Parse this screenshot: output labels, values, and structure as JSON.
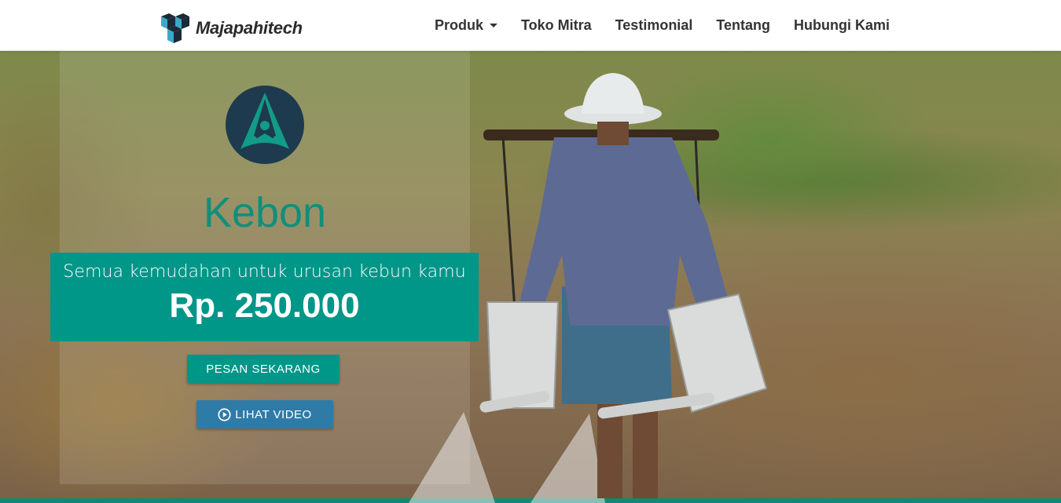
{
  "brand": {
    "name": "Majapahitech"
  },
  "nav": {
    "items": [
      {
        "label": "Produk",
        "has_dropdown": true
      },
      {
        "label": "Toko Mitra"
      },
      {
        "label": "Testimonial"
      },
      {
        "label": "Tentang"
      },
      {
        "label": "Hubungi Kami"
      }
    ]
  },
  "hero": {
    "app_name": "Kebon",
    "tagline": "Semua kemudahan untuk urusan kebun kamu",
    "price": "Rp. 250.000",
    "order_button": "PESAN SEKARANG",
    "video_button": "LIHAT VIDEO"
  },
  "colors": {
    "primary": "#009688",
    "video_button": "#2f7ba7",
    "logo_dark": "#1d3a4f",
    "logo_teal": "#0f8f7c"
  },
  "icons": {
    "brand": "cube-logo-icon",
    "app": "kebon-logo-icon",
    "video": "play-circle-icon",
    "dropdown": "caret-down-icon"
  }
}
